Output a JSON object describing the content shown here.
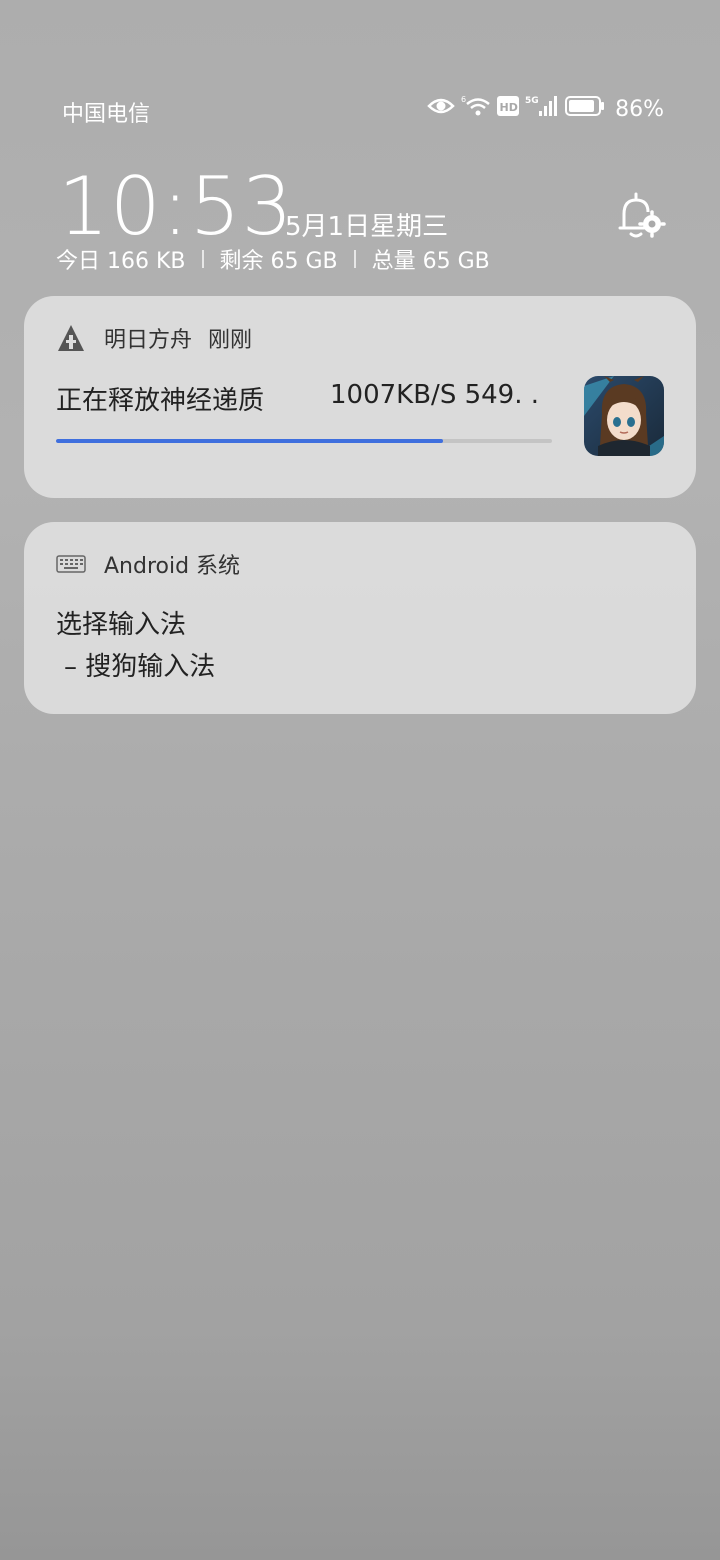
{
  "status_bar": {
    "carrier": "中国电信",
    "icons": [
      "eye-icon",
      "wifi-icon",
      "hd-icon",
      "cellular-5g-icon",
      "battery-icon"
    ],
    "battery_percent": "86%"
  },
  "lockscreen": {
    "time": "10:53",
    "date": "5月1日星期三",
    "data_usage": {
      "today": "今日 166 KB",
      "remaining": "剩余 65 GB",
      "total": "总量 65 GB"
    }
  },
  "notifications": [
    {
      "app_name": "明日方舟",
      "time": "刚刚",
      "title": "正在释放神经递质",
      "detail": "1007KB/S 549. .",
      "progress": 0.78
    },
    {
      "app_name": "Android 系统",
      "line1": "选择输入法",
      "line2": "– 搜狗输入法"
    }
  ],
  "colors": {
    "progress_fill": "#3f6fde",
    "card_background": "#dedede"
  }
}
